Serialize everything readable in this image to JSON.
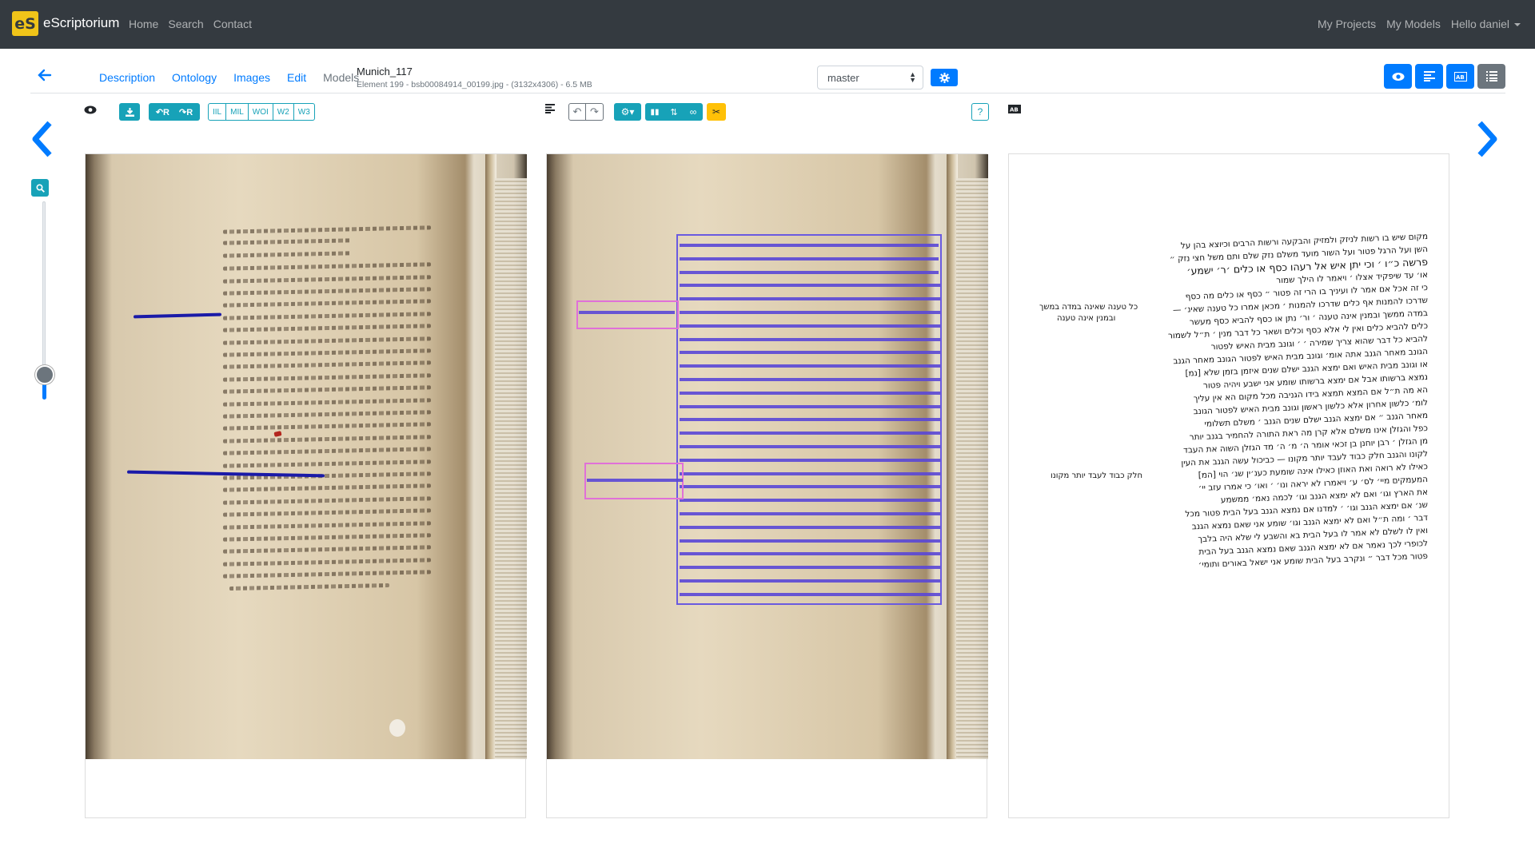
{
  "navbar": {
    "brand": "eScriptorium",
    "logo_text": "eS",
    "links": [
      "Home",
      "Search",
      "Contact"
    ],
    "right_links": [
      "My Projects",
      "My Models",
      "Hello daniel"
    ]
  },
  "document": {
    "tabs": [
      "Description",
      "Ontology",
      "Images",
      "Edit",
      "Models"
    ],
    "title": "Munich_117",
    "subtitle": "Element 199 - bsb00084914_00199.jpg - (3132x4306) - 6.5 MB",
    "branch": "master"
  },
  "toolbar_left": {
    "export_labels": [
      "IIL",
      "MIL",
      "WOI",
      "W2",
      "W3"
    ]
  },
  "toolbar_right": {
    "help": "?"
  },
  "transcription": {
    "lines": [
      "מקום שיש בו רשות לניזק ולמזיק והבקעה ורשות הרבים וכיוצא בהן על",
      "השן ועל הרגל פטור ועל השור מועד משלם נזק שלם ותם משל חצי נזק ״",
      "פרשה כ״ו ׳ וכי יתן איש אל רעהו כסף או כלים ׳ר׳ ישמע׳",
      "או׳ עד שיפקיד אצלו ׳ ויאמר לו הילך שמור",
      "כי זה אכל אם אמר לו ועיניך בו הרי זה פטור ״ כסף או כלים מה כסף",
      "שדרכו להמנות אף כלים שדרכו להמנות ׳ מכאן אמרו כל טענה שאינ׳ —",
      "במדה ממשך ובמנין אינה טענה ׳ ור׳ נתן או כסף להביא כסף מעשר",
      "כלים להביא כלים ואין לי אלא כסף וכלים ושאר כל דבר מנין ׳ ת״ל לשמור",
      "להביא כל דבר שהוא צריך שמירה ׳ ׳ וגונב מבית האיש לפטור",
      "הגונב מאחר הגנב אתה אומ׳ וגונב מבית האיש לפטור הגונב מאחר הגנב",
      "או וגונב מבית האיש ואם ימצא הגנב ישלם שנים איזמן בזמן שלא [נמ]",
      "נמצא ברשותו אבל אם ימצא ברשותו שומע אני ישבע ויהיה פטור",
      "הא מה ת״ל אם המצא תמצא בידו הגניבה מכל מקום הא אין עליך",
      "לומ׳ כלשון אחרון אלא כלשון ראשון וגונב מבית האיש לפטור הגונב",
      "מאחר הגנב ״ אם ימצא הגנב ישלם שנים הגנב ׳ משלם תשלומי",
      "כפל והגזלן אינו משלם אלא קרן מה ראת התורה להחמיר בגנב יותר",
      "מן הגזלן ׳ רבן יוחנן בן זכאי אומר ה׳ מ׳ ה׳ מד הגזלן השוה את העבד",
      "לקונו והגנב חלק כבוד לעבד יותר מקונו — כביכול עשה הגנב את העין",
      "כאילו לא רואה ואת האוזן כאילו אינה שומעת כענ׳ין שנ׳ הוי [המ]",
      "המעמקים מיי׳ לס׳ ע׳ ויאמרו לא יראה ונו׳ ׳ ואו׳ כי אמרו עזב יי׳",
      "את הארץ וגו׳ ואם לא ימצא הגנב וגו׳ לכמה נאמ׳ ממשמע",
      "שנ׳ אם ימצא הגנב וגו׳ ׳ למדנו אם נמצא הגנב בעל הבית פטור מכל",
      "דבר ׳ ומה ת״ל ואם לא ימצא הגנב וגו׳ שומע אני שאם נמצא הגנב",
      "ואין לו לשלם לא אמר לו בעל הבית בא והשבע לי שלא היה בלבך",
      "לכופרי לכך נאמר אם לא ימצא הגנב שאם נמצא הגנב בעל הבית",
      "פטור מכל דבר ״ ונקרב בעל הבית שומע אני ישאל באורים ותומי׳"
    ],
    "margin_notes": [
      "כל טענה שאינה במדה במשך",
      "ובמנין אינה טענה",
      "חלק כבוד לעבד יותר מקונו"
    ]
  },
  "colors": {
    "navbar": "#343a40",
    "primary": "#007bff",
    "info": "#17a2b8",
    "warning": "#ffc107",
    "baseline_blue": "#1a1aa8",
    "region_violet": "#6a5ae0",
    "region_pink": "#e070d8"
  },
  "icons": {
    "back": "arrow-left-icon",
    "prev": "chevron-left-icon",
    "next": "chevron-right-icon",
    "zoom": "zoom-icon",
    "gear": "gear-icon"
  }
}
